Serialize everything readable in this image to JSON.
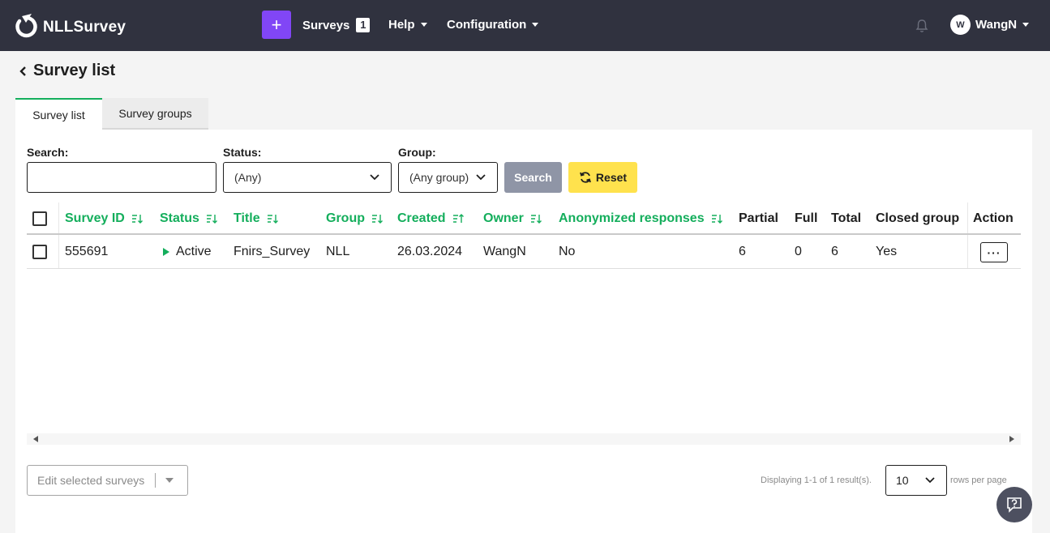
{
  "navbar": {
    "brand": "NLLSurvey",
    "add_label": "+",
    "surveys_label": "Surveys",
    "surveys_count": "1",
    "help_label": "Help",
    "configuration_label": "Configuration",
    "user_initial": "W",
    "user_name": "WangN"
  },
  "page": {
    "title": "Survey list"
  },
  "tabs": [
    {
      "label": "Survey list",
      "active": true
    },
    {
      "label": "Survey groups",
      "active": false
    }
  ],
  "filters": {
    "search_label": "Search:",
    "search_value": "",
    "status_label": "Status:",
    "status_value": "(Any)",
    "group_label": "Group:",
    "group_value": "(Any group)",
    "search_button": "Search",
    "reset_button": "Reset"
  },
  "table": {
    "columns": {
      "survey_id": "Survey ID",
      "status": "Status",
      "title": "Title",
      "group": "Group",
      "created": "Created",
      "owner": "Owner",
      "anonymized": "Anonymized responses",
      "partial": "Partial",
      "full": "Full",
      "total": "Total",
      "closed_group": "Closed group",
      "action": "Action"
    },
    "rows": [
      {
        "survey_id": "555691",
        "status": "Active",
        "title": "Fnirs_Survey",
        "group": "NLL",
        "created": "26.03.2024",
        "owner": "WangN",
        "anonymized": "No",
        "partial": "6",
        "full": "0",
        "total": "6",
        "closed_group": "Yes",
        "action": "···"
      }
    ]
  },
  "footer": {
    "mass_action": "Edit selected surveys",
    "summary": "Displaying 1-1 of 1 result(s).",
    "page_size": "10",
    "rows_per_page": "rows per page"
  },
  "colors": {
    "navbar": "#30323f",
    "accent_green": "#14ae5c",
    "plus_button": "#8146f6",
    "reset_button": "#ffe24d",
    "search_button": "#8f95a6"
  }
}
